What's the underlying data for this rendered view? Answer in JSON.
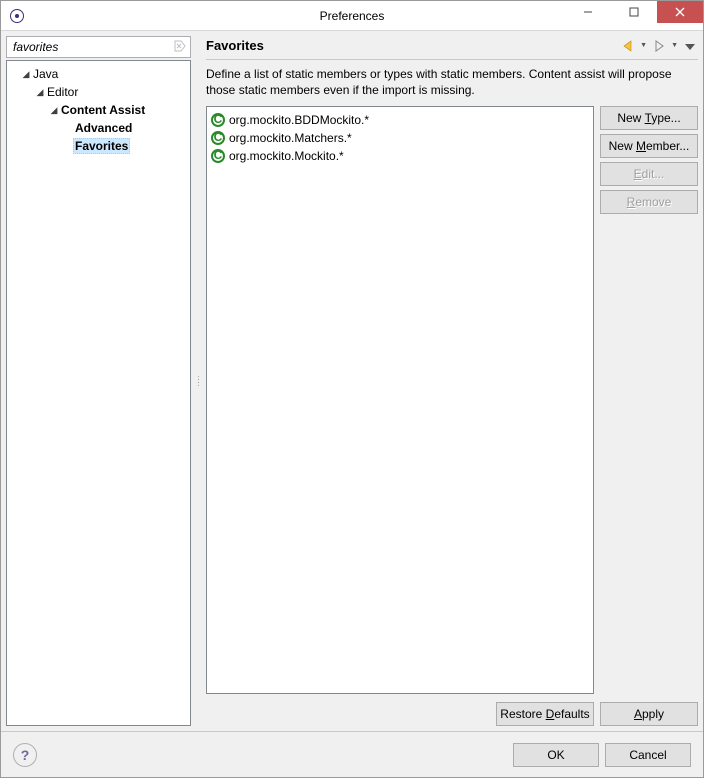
{
  "window": {
    "title": "Preferences"
  },
  "filter": {
    "value": "favorites"
  },
  "tree": {
    "items": [
      {
        "label": "Java",
        "indent": 1,
        "expanded": true,
        "bold": false,
        "selected": false,
        "arrow": true
      },
      {
        "label": "Editor",
        "indent": 2,
        "expanded": true,
        "bold": false,
        "selected": false,
        "arrow": true
      },
      {
        "label": "Content Assist",
        "indent": 3,
        "expanded": true,
        "bold": true,
        "selected": false,
        "arrow": true
      },
      {
        "label": "Advanced",
        "indent": 4,
        "expanded": false,
        "bold": true,
        "selected": false,
        "arrow": false
      },
      {
        "label": "Favorites",
        "indent": 4,
        "expanded": false,
        "bold": true,
        "selected": true,
        "arrow": false
      }
    ]
  },
  "page": {
    "title": "Favorites",
    "description": "Define a list of static members or types with static members. Content assist will propose those static members even if the import is missing."
  },
  "favorites": {
    "items": [
      {
        "label": "org.mockito.BDDMockito.*"
      },
      {
        "label": "org.mockito.Matchers.*"
      },
      {
        "label": "org.mockito.Mockito.*"
      }
    ]
  },
  "buttons": {
    "new_type": "New Type...",
    "new_member": "New Member...",
    "edit": "Edit...",
    "remove": "Remove",
    "restore_defaults": "Restore Defaults",
    "apply": "Apply",
    "ok": "OK",
    "cancel": "Cancel"
  }
}
